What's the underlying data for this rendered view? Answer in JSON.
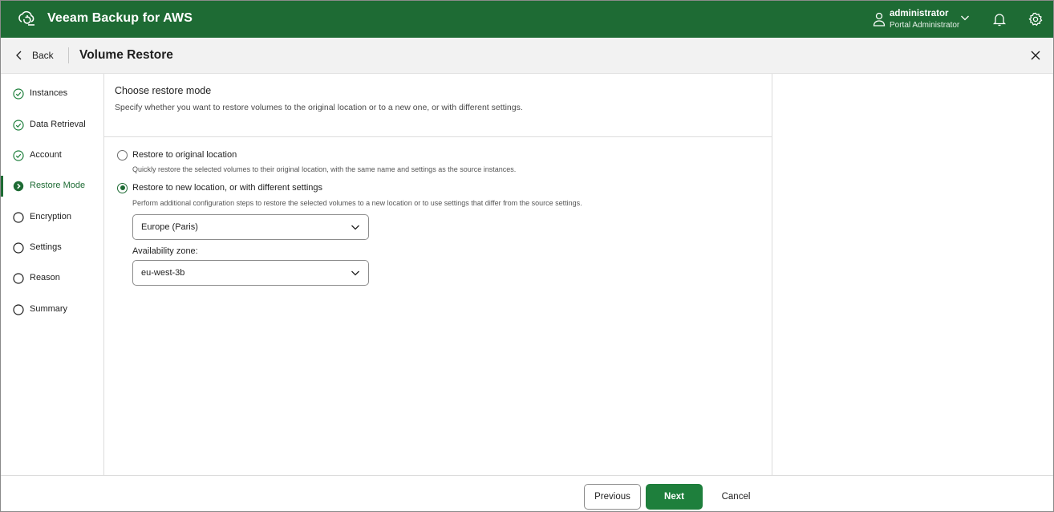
{
  "app": {
    "title": "Veeam Backup for AWS",
    "brand_color": "#1e6b34"
  },
  "user": {
    "name": "administrator",
    "role": "Portal Administrator"
  },
  "header": {
    "back_label": "Back",
    "title": "Volume Restore"
  },
  "steps": [
    {
      "label": "Instances",
      "state": "completed"
    },
    {
      "label": "Data Retrieval",
      "state": "completed"
    },
    {
      "label": "Account",
      "state": "completed"
    },
    {
      "label": "Restore Mode",
      "state": "active"
    },
    {
      "label": "Encryption",
      "state": "pending"
    },
    {
      "label": "Settings",
      "state": "pending"
    },
    {
      "label": "Reason",
      "state": "pending"
    },
    {
      "label": "Summary",
      "state": "pending"
    }
  ],
  "main": {
    "section_title": "Choose restore mode",
    "section_desc": "Specify whether you want to restore volumes to the original location or to a new one, or with different settings.",
    "options": [
      {
        "label": "Restore to original location",
        "description": "Quickly restore the selected volumes to their original location, with the same name and settings as the source instances.",
        "selected": false
      },
      {
        "label": "Restore to new location, or with different settings",
        "description": "Perform additional configuration steps to restore the selected volumes to a new location or to use settings that differ from the source settings.",
        "selected": true
      }
    ],
    "region_value": "Europe (Paris)",
    "az_label": "Availability zone:",
    "az_value": "eu-west-3b"
  },
  "footer": {
    "previous_label": "Previous",
    "next_label": "Next",
    "cancel_label": "Cancel"
  }
}
